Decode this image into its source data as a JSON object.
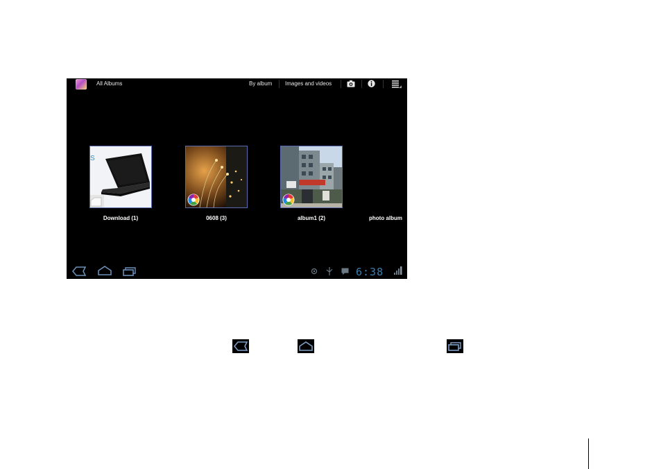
{
  "actionbar": {
    "title": "All Albums",
    "by_album": "By album",
    "images_and_videos": "Images and videos",
    "camera_icon": "camera-icon",
    "info_icon": "info-icon",
    "menu_icon": "menu-icon"
  },
  "albums": [
    {
      "label": "Download (1)",
      "thumb": "laptop"
    },
    {
      "label": "0608 (3)",
      "thumb": "lights"
    },
    {
      "label": "album1 (2)",
      "thumb": "building"
    },
    {
      "label": "photo album"
    }
  ],
  "systembar": {
    "time": "6:38",
    "icons": [
      "back-icon",
      "home-icon",
      "recent-apps-icon",
      "gps-icon",
      "usb-icon",
      "message-icon",
      "signal-icon"
    ]
  },
  "colors": {
    "clock": "#3b7fb0",
    "screen_bg": "#000000",
    "thumb_border": "#5b6bb0"
  }
}
